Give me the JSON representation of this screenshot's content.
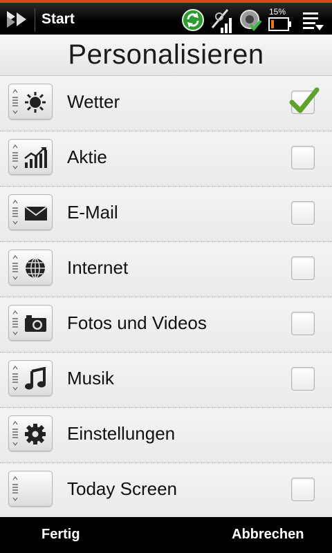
{
  "statusbar": {
    "start_label": "Start",
    "battery_percent": "15%",
    "icons": [
      "start-logo-icon",
      "sync-icon",
      "signal-icon",
      "volume-icon",
      "battery-icon",
      "menu-icon"
    ],
    "accent_color": "#d9481a"
  },
  "page": {
    "title": "Personalisieren"
  },
  "list": {
    "items": [
      {
        "label": "Wetter",
        "icon": "weather-sun-icon",
        "checked": true,
        "has_checkbox": true
      },
      {
        "label": "Aktie",
        "icon": "stocks-chart-icon",
        "checked": false,
        "has_checkbox": true
      },
      {
        "label": "E-Mail",
        "icon": "mail-envelope-icon",
        "checked": false,
        "has_checkbox": true
      },
      {
        "label": "Internet",
        "icon": "globe-icon",
        "checked": false,
        "has_checkbox": true
      },
      {
        "label": "Fotos und Videos",
        "icon": "camera-icon",
        "checked": false,
        "has_checkbox": true
      },
      {
        "label": "Musik",
        "icon": "music-note-icon",
        "checked": false,
        "has_checkbox": true
      },
      {
        "label": "Einstellungen",
        "icon": "gear-icon",
        "checked": false,
        "has_checkbox": false
      },
      {
        "label": "Today Screen",
        "icon": "blank-icon",
        "checked": false,
        "has_checkbox": true
      }
    ]
  },
  "softkeys": {
    "left": "Fertig",
    "right": "Abbrechen"
  },
  "colors": {
    "check": "#5ea12d"
  }
}
